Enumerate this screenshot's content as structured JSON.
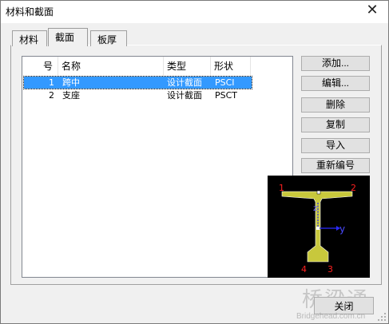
{
  "window": {
    "title": "材料和截面",
    "close_glyph": "✕"
  },
  "tabs": [
    {
      "label": "材料",
      "active": false
    },
    {
      "label": "截面",
      "active": true
    },
    {
      "label": "板厚",
      "active": false
    }
  ],
  "table": {
    "columns": [
      "号",
      "名称",
      "类型",
      "形状"
    ],
    "rows": [
      {
        "no": "1",
        "name": "跨中",
        "type": "设计截面",
        "shape": "PSCI",
        "selected": true
      },
      {
        "no": "2",
        "name": "支座",
        "type": "设计截面",
        "shape": "PSCT",
        "selected": false
      }
    ]
  },
  "buttons": {
    "add": "添加...",
    "edit": "编辑...",
    "delete": "删除",
    "copy": "复制",
    "import": "导入",
    "renumber": "重新编号",
    "close": "关闭"
  },
  "preview": {
    "points": [
      "1",
      "2",
      "3",
      "4"
    ],
    "axis_z": "z",
    "axis_y": "y",
    "colors": {
      "section": "#c8c83c",
      "outline": "#ffffff",
      "points": "#ff2020",
      "axis": "#2a2aff",
      "background": "#000000"
    }
  },
  "watermark": {
    "cn": "桥梁通",
    "en": "Bridgehead.com.cn"
  }
}
